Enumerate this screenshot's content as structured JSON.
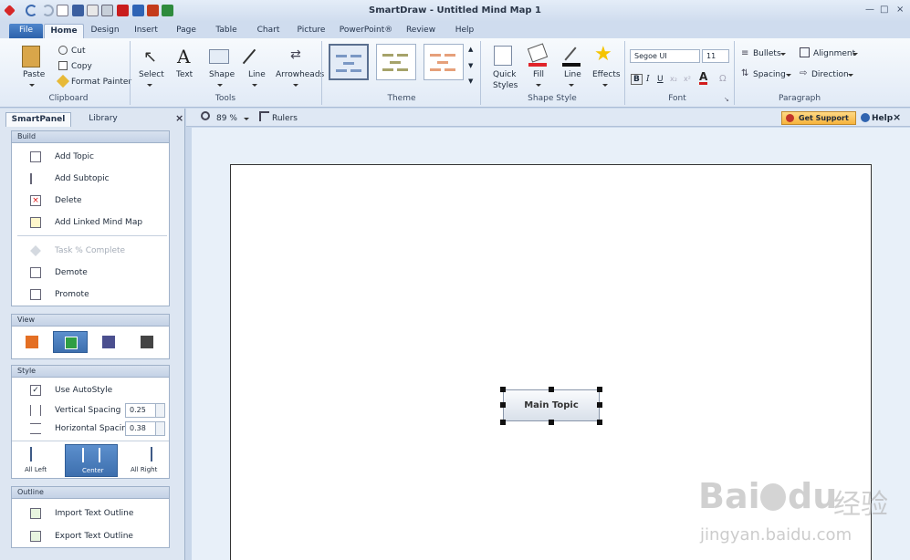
{
  "app": {
    "title": "SmartDraw - Untitled Mind Map 1"
  },
  "window_controls": [
    "—",
    "□",
    "×"
  ],
  "tabs": [
    {
      "label": "File"
    },
    {
      "label": "Home"
    },
    {
      "label": "Design"
    },
    {
      "label": "Insert"
    },
    {
      "label": "Page"
    },
    {
      "label": "Table"
    },
    {
      "label": "Chart"
    },
    {
      "label": "Picture"
    },
    {
      "label": "PowerPoint®"
    },
    {
      "label": "Review"
    },
    {
      "label": "Help"
    }
  ],
  "ribbon": {
    "clipboard": {
      "paste": "Paste",
      "cut": "Cut",
      "copy": "Copy",
      "format_painter": "Format Painter",
      "label": "Clipboard"
    },
    "tools": {
      "select": "Select",
      "text": "Text",
      "shape": "Shape",
      "line": "Line",
      "arrowheads": "Arrowheads",
      "label": "Tools"
    },
    "theme": {
      "label": "Theme"
    },
    "shape_style": {
      "quick": "Quick",
      "styles": "Styles",
      "fill": "Fill",
      "line": "Line",
      "effects": "Effects",
      "label": "Shape Style"
    },
    "font": {
      "face": "Segoe UI",
      "size": "11",
      "bold": "B",
      "italic": "I",
      "underline": "U",
      "label": "Font"
    },
    "paragraph": {
      "bullets": "Bullets",
      "spacing": "Spacing",
      "alignment": "Alignment",
      "direction": "Direction",
      "label": "Paragraph"
    }
  },
  "left_panel": {
    "tabs": [
      "SmartPanel",
      "Library"
    ],
    "build": {
      "title": "Build",
      "items": [
        "Add Topic",
        "Add Subtopic",
        "Delete",
        "Add Linked Mind Map",
        "Task % Complete",
        "Demote",
        "Promote"
      ]
    },
    "view": {
      "title": "View"
    },
    "style": {
      "title": "Style",
      "use_autostyle": "Use AutoStyle",
      "vertical_spacing": "Vertical Spacing",
      "vertical_value": "0.25",
      "horizontal_spacing": "Horizontal Spacing",
      "horizontal_value": "0.38",
      "layouts": [
        "All Left",
        "Center",
        "All Right"
      ]
    },
    "outline": {
      "title": "Outline",
      "items": [
        "Import Text Outline",
        "Export Text Outline"
      ]
    }
  },
  "canvas_toolbar": {
    "zoom": "89 %",
    "rulers": "Rulers",
    "support": "Get Support",
    "help": "Help"
  },
  "canvas": {
    "main_topic": "Main Topic"
  },
  "watermark": {
    "line1": "Bai",
    "du": "du",
    "cn": "经验",
    "url": "jingyan.baidu.com"
  },
  "colors": {
    "accent": "#2c62ab",
    "fill_red": "#e0242a",
    "effects_star": "#f5c400"
  }
}
